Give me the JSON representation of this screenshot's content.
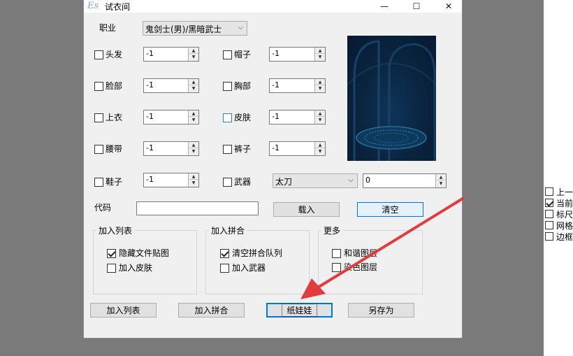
{
  "window": {
    "title": "试衣间",
    "icon_text": "Es",
    "controls": {
      "minimize": "—",
      "maximize": "☐",
      "close": "✕"
    }
  },
  "job": {
    "label": "职业",
    "value": "鬼剑士(男)/黑暗武士"
  },
  "slots": {
    "hair": {
      "label": "头发",
      "value": "-1",
      "checked": false
    },
    "hat": {
      "label": "帽子",
      "value": "-1",
      "checked": false
    },
    "face": {
      "label": "脸部",
      "value": "-1",
      "checked": false
    },
    "chest": {
      "label": "胸部",
      "value": "-1",
      "checked": false
    },
    "top": {
      "label": "上衣",
      "value": "-1",
      "checked": false
    },
    "skin": {
      "label": "皮肤",
      "value": "-1",
      "checked": false
    },
    "belt": {
      "label": "腰带",
      "value": "-1",
      "checked": false
    },
    "pants": {
      "label": "裤子",
      "value": "-1",
      "checked": false
    },
    "shoes": {
      "label": "鞋子",
      "value": "-1",
      "checked": false
    },
    "weapon": {
      "label": "武器",
      "type": "太刀",
      "value": "0",
      "checked": false
    }
  },
  "code": {
    "label": "代码",
    "value": "",
    "load_button": "载入",
    "clear_button": "清空"
  },
  "groups": {
    "add_list": {
      "title": "加入列表",
      "options": [
        {
          "label": "隐藏文件贴图",
          "checked": true
        },
        {
          "label": "加入皮肤",
          "checked": false
        }
      ]
    },
    "add_merge": {
      "title": "加入拼合",
      "options": [
        {
          "label": "清空拼合队列",
          "checked": true
        },
        {
          "label": "加入武器",
          "checked": false
        }
      ]
    },
    "more": {
      "title": "更多",
      "options": [
        {
          "label": "和谐图层",
          "checked": false
        },
        {
          "label": "染色图层",
          "checked": false
        }
      ]
    }
  },
  "bottom_buttons": {
    "add_list": "加入列表",
    "add_merge": "加入拼合",
    "paper_doll": "纸娃娃",
    "save_as": "另存为"
  },
  "right_panel": [
    {
      "label": "上一",
      "checked": false
    },
    {
      "label": "当前",
      "checked": true
    },
    {
      "label": "标尺",
      "checked": false
    },
    {
      "label": "网格",
      "checked": false
    },
    {
      "label": "边框",
      "checked": false
    }
  ],
  "colors": {
    "arrow": "#e23b3b",
    "accent": "#0078d7",
    "preview_bg": "#0a2440"
  }
}
